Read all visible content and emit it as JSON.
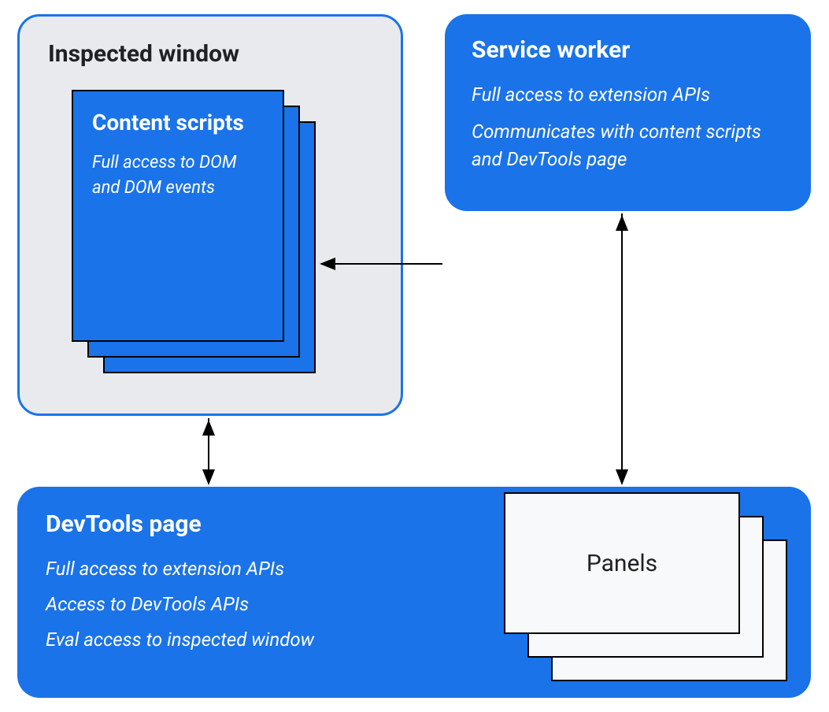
{
  "inspected_window": {
    "title": "Inspected window",
    "content_scripts": {
      "title": "Content scripts",
      "desc": "Full access to DOM and DOM events"
    }
  },
  "service_worker": {
    "title": "Service worker",
    "desc1": "Full access to extension APIs",
    "desc2": "Communicates with content scripts and DevTools page"
  },
  "devtools_page": {
    "title": "DevTools page",
    "desc1": "Full access to extension APIs",
    "desc2": "Access to DevTools APIs",
    "desc3": "Eval access to inspected window",
    "panels_label": "Panels"
  }
}
